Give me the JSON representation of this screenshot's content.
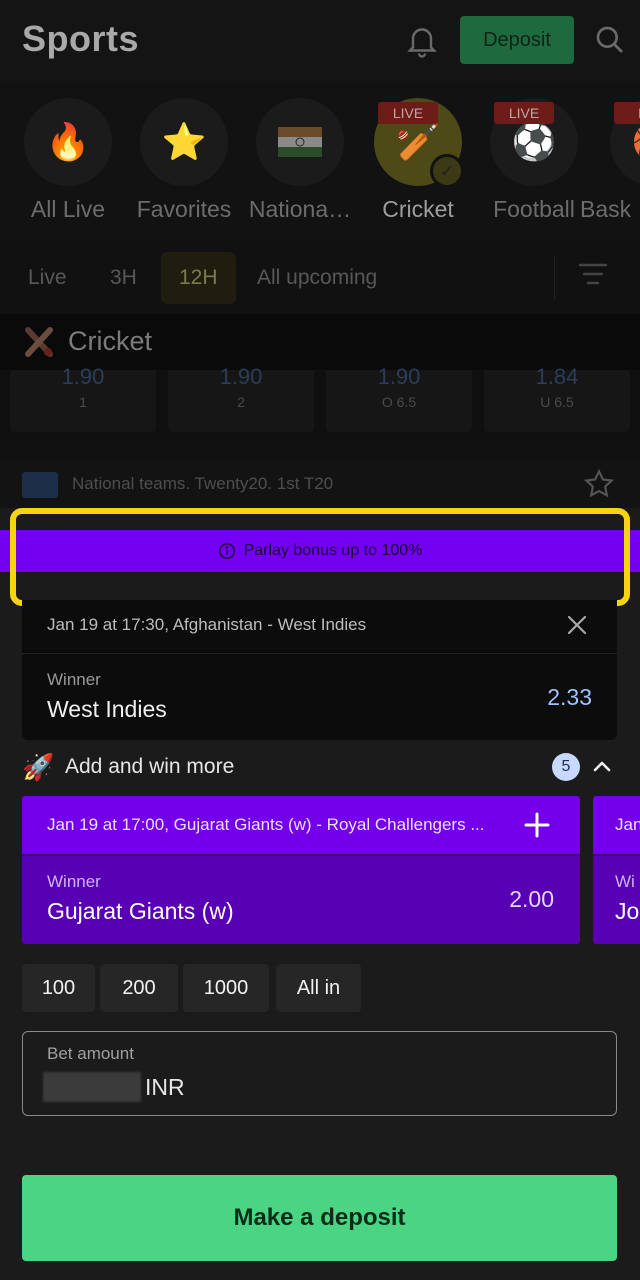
{
  "header": {
    "title": "Sports",
    "deposit_label": "Deposit"
  },
  "sports": [
    {
      "label": "All Live",
      "icon": "fire-icon",
      "glyph": "🔥"
    },
    {
      "label": "Favorites",
      "icon": "star-icon",
      "glyph": "⭐"
    },
    {
      "label": "Nationa…",
      "icon": "india-flag-icon",
      "glyph": ""
    },
    {
      "label": "Cricket",
      "icon": "cricket-icon",
      "glyph": "🏏",
      "live": "LIVE",
      "selected": true
    },
    {
      "label": "Football",
      "icon": "football-icon",
      "glyph": "⚽",
      "live": "LIVE"
    },
    {
      "label": "Bask",
      "icon": "basketball-icon",
      "glyph": "🏀",
      "live": "LI"
    }
  ],
  "filters": [
    {
      "label": "Live"
    },
    {
      "label": "3H"
    },
    {
      "label": "12H",
      "active": true
    },
    {
      "label": "All upcoming"
    }
  ],
  "section": {
    "title": "Cricket"
  },
  "odds": [
    {
      "value": "1.90",
      "label": "1"
    },
    {
      "value": "1.90",
      "label": "2"
    },
    {
      "value": "1.90",
      "label": "O 6.5"
    },
    {
      "value": "1.84",
      "label": "U 6.5"
    }
  ],
  "event_line": {
    "text": "National teams. Twenty20. 1st T20"
  },
  "parlay": {
    "text": "Parlay bonus up to 100%"
  },
  "bet": {
    "match": "Jan 19 at 17:30, Afghanistan - West Indies",
    "market": "Winner",
    "selection": "West Indies",
    "odd": "2.33"
  },
  "more": {
    "label": "Add and win more",
    "count": "5"
  },
  "suggestions": [
    {
      "match": "Jan 19 at 17:00, Gujarat Giants (w) - Royal Challengers ...",
      "market": "Winner",
      "selection": "Gujarat Giants (w)",
      "odd": "2.00"
    },
    {
      "match": "Jan",
      "market": "Wi",
      "selection": "Jo",
      "odd": ""
    }
  ],
  "quick_amounts": [
    "100",
    "200",
    "1000",
    "All in"
  ],
  "amount": {
    "label": "Bet amount",
    "currency": "INR"
  },
  "cta": {
    "label": "Make a deposit"
  }
}
